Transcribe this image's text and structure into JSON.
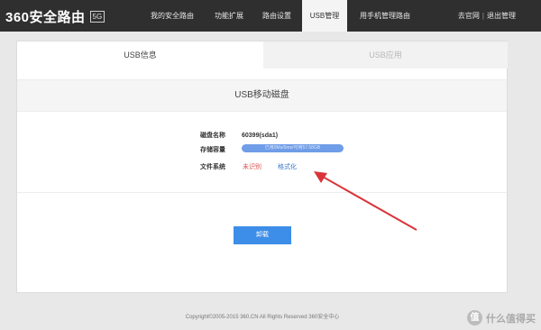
{
  "header": {
    "logo_text": "360安全路由",
    "logo_badge": "5G",
    "nav": [
      {
        "label": "我的安全路由"
      },
      {
        "label": "功能扩展"
      },
      {
        "label": "路由设置"
      },
      {
        "label": "USB管理"
      },
      {
        "label": "用手机管理路由"
      }
    ],
    "active_nav": "USB管理",
    "links": {
      "official_site": "去官网",
      "separator": "|",
      "logout": "退出管理"
    }
  },
  "tabs": [
    {
      "label": "USB信息",
      "active": true
    },
    {
      "label": "USB应用",
      "active": false
    }
  ],
  "section_title": "USB移动磁盘",
  "disk": {
    "name_label": "磁盘名称",
    "name_value": "60399(sda1)",
    "capacity_label": "存储容量",
    "capacity_text": "已用0Ms/0ms/可用57.58GB",
    "capacity_used_fraction": 0.0,
    "fs_label": "文件系统",
    "fs_value": "未识别",
    "format_link": "格式化"
  },
  "unmount_button": "卸载",
  "footer": {
    "copyright": "Copyright©2005-2015 360.CN All Rights Reserved 360安全中心"
  },
  "watermark": {
    "icon_char": "值",
    "text": "什么值得买"
  },
  "colors": {
    "topbar": "#2f2f2f",
    "accent_blue": "#3d8ee8",
    "warning_red": "#d9534f",
    "link_blue": "#3b78c8",
    "arrow_red": "#d9343a"
  }
}
